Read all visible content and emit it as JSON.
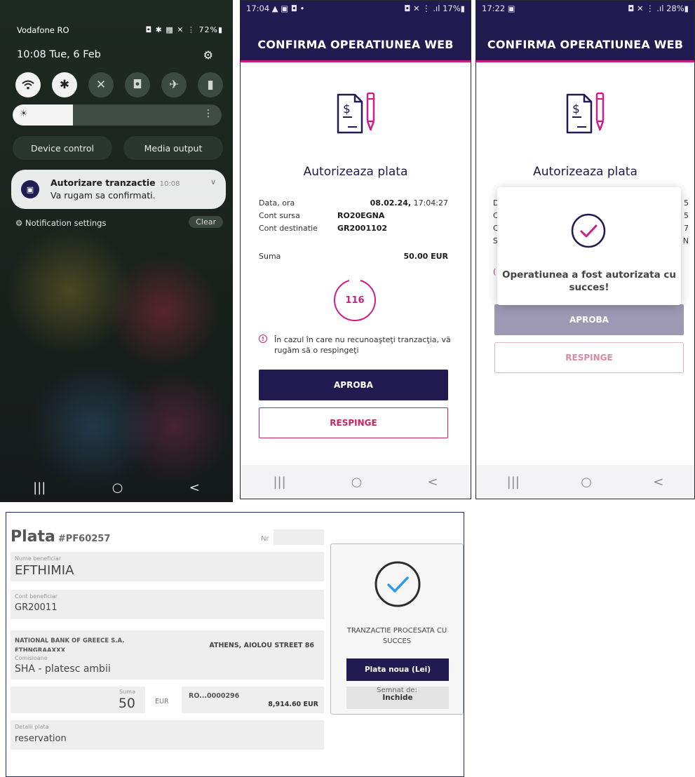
{
  "shade": {
    "carrier": "Vodafone RO",
    "status_icons": "◘ ✱ ▩ ✕ ⋮ 72%▮",
    "time_date": "10:08 Tue, 6 Feb",
    "brightness_level": 0.29,
    "buttons": {
      "device_control": "Device control",
      "media_output": "Media output"
    },
    "notification": {
      "title": "Autorizare tranzactie",
      "time": "10:08",
      "text": "Va rugam sa confirmati."
    },
    "notification_settings": "Notification settings",
    "clear": "Clear"
  },
  "phone_a": {
    "status_time": "17:04 ▲ ▣ ◘  •",
    "status_right": "◘ ✕ ⋮ .ıl 17%▮",
    "title": "CONFIRMA OPERATIUNEA WEB",
    "heading": "Autorizeaza plata",
    "rows": [
      {
        "label": "Data, ora",
        "value": "08.02.24,",
        "value_extra": "17:04:27"
      },
      {
        "label": "Cont sursa",
        "value": "RO20EGNA"
      },
      {
        "label": "Cont destinatie",
        "value": "GR2001102"
      }
    ],
    "amount_label": "Suma",
    "amount_value": "50.00 EUR",
    "timer": "116",
    "warning": "În cazul în care nu recunoaşteţi tranzacţia, vă rugăm să o respingeţi",
    "approve": "APROBA",
    "reject": "RESPINGE"
  },
  "phone_b": {
    "status_time": "17:22 ▣",
    "status_right": "◘ ✕ ⋮ .ıl 28%▮",
    "title": "CONFIRMA OPERATIUNEA WEB",
    "heading": "Autorizeaza plata",
    "left_edge": [
      "D",
      "C",
      "C",
      "S"
    ],
    "right_edge": [
      "5",
      "5",
      "7",
      "N"
    ],
    "edge_mark": "(",
    "success_message": "Operatiunea a fost autorizata cu succes!",
    "approve": "APROBA",
    "reject": "RESPINGE"
  },
  "navbar": {
    "recents": "|||",
    "home": "○",
    "back": "<"
  },
  "web": {
    "title": "Plata",
    "payment_id": "#PF60257",
    "nr_label": "Nr",
    "beneficiary_label": "Nume beneficiar",
    "beneficiary_value": "EFTHIMIA",
    "account_label": "Cont beneficiar",
    "account_value": "GR20011",
    "bank_name": "NATIONAL BANK OF GREECE S.A.",
    "bank_bic": "ETHNGRAAXXX",
    "bank_address": "ATHENS, AIOLOU STREET 86",
    "fees_label": "Comisioane",
    "fees_value": "SHA - platesc ambii",
    "sum_label": "Suma",
    "sum_value": "50",
    "currency": "EUR",
    "source_account": "RO...0000296",
    "source_balance": "8,914.60 EUR",
    "details_label": "Detalii plata",
    "details_value": "reservation",
    "success_message": "TRANZACTIE PROCESATA CU SUCCES",
    "new_payment": "Plata noua (Lei)",
    "close": "Inchide",
    "signed_by": "Semnat de:"
  },
  "colors": {
    "brand_navy": "#221b51",
    "accent_magenta": "#d01f84",
    "reject_red": "#c8255f",
    "check_blue": "#2e9be6"
  }
}
